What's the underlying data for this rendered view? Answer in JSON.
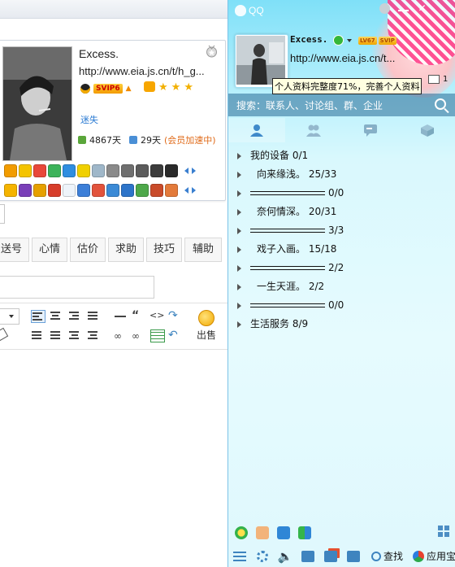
{
  "forum": {
    "profile": {
      "name": "Excess.",
      "url": "http://www.eia.js.cn/t/h_g...",
      "vip_label": "SVIP6",
      "status": "迷失",
      "online_days": "4867天",
      "member_days": "29天",
      "member_accel": "(会员加速中)"
    },
    "tabs": [
      "送号",
      "心情",
      "估价",
      "求助",
      "技巧",
      "辅助"
    ],
    "sell_label": "出售"
  },
  "qq": {
    "app_title": "QQ",
    "nickname": "Excess.",
    "vip_badges": [
      "LV67",
      "SVIP"
    ],
    "signature": "http://www.eia.js.cn/t...",
    "tooltip": "个人资料完整度71%，完善个人资料",
    "mail_count": "1",
    "search_placeholder": "搜索：联系人、讨论组、群、企业",
    "groups": [
      {
        "name": "我的设备",
        "count": "0/1",
        "dash": false,
        "indent": false
      },
      {
        "name": "向来缘浅。",
        "count": "25/33",
        "dash": false,
        "indent": true
      },
      {
        "name": "",
        "count": "0/0",
        "dash": true,
        "indent": false
      },
      {
        "name": "奈何情深。",
        "count": "20/31",
        "dash": false,
        "indent": true
      },
      {
        "name": "",
        "count": "3/3",
        "dash": true,
        "indent": false
      },
      {
        "name": "戏子入画。",
        "count": "15/18",
        "dash": false,
        "indent": true
      },
      {
        "name": "",
        "count": "2/2",
        "dash": true,
        "indent": false
      },
      {
        "name": "一生天涯。",
        "count": "2/2",
        "dash": false,
        "indent": true
      },
      {
        "name": "",
        "count": "0/0",
        "dash": true,
        "indent": false
      },
      {
        "name": "生活服务",
        "count": "8/9",
        "dash": false,
        "indent": false
      }
    ],
    "find_label": "查找",
    "appstore_label": "应用宝"
  },
  "colors": {
    "qq_bg_top": "#7fe0f8",
    "qq_bg_bottom": "#e6fbfe",
    "accent_blue": "#3e84bf",
    "member_accel": "#e06a18",
    "status_link": "#2b7bd3"
  }
}
